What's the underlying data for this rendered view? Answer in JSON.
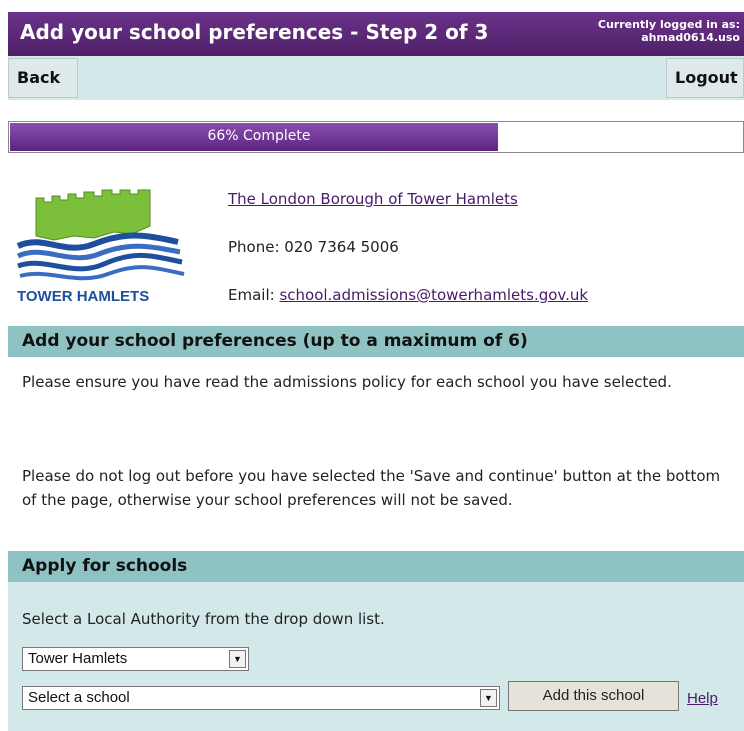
{
  "header": {
    "title": "Add your school preferences - Step 2 of 3",
    "login_label": "Currently logged in as:",
    "username": "ahmad0614.uso"
  },
  "nav": {
    "back": "Back",
    "logout": "Logout"
  },
  "progress": {
    "label": "66% Complete",
    "value": 0.66
  },
  "logo": {
    "text": "TOWER HAMLETS"
  },
  "contact": {
    "org": "The London Borough of Tower Hamlets",
    "phone": "Phone: 020 7364 5006",
    "email_label": "Email:",
    "email": "school.admissions@towerhamlets.gov.uk"
  },
  "preferences": {
    "heading": "Add your school preferences (up to a maximum of 6)",
    "para1": "Please ensure you have read the admissions policy for each school you have selected.",
    "para2": "Please do not log out before you have selected the 'Save and continue' button at the bottom of the page, otherwise your school preferences will not be saved."
  },
  "apply": {
    "heading": "Apply for schools",
    "instruction": "Select a Local Authority from the drop down list.",
    "authority_value": "Tower Hamlets",
    "school_value": "Select a school",
    "add_button": "Add this school",
    "help": "Help"
  },
  "colors": {
    "header": "#5b2a7a",
    "section": "#8fc3c3",
    "panel": "#d3e8e8",
    "link": "#4a1a6a"
  },
  "icons": {
    "dropdown": "chevron-down-icon",
    "logo": "tower-hamlets-logo"
  }
}
